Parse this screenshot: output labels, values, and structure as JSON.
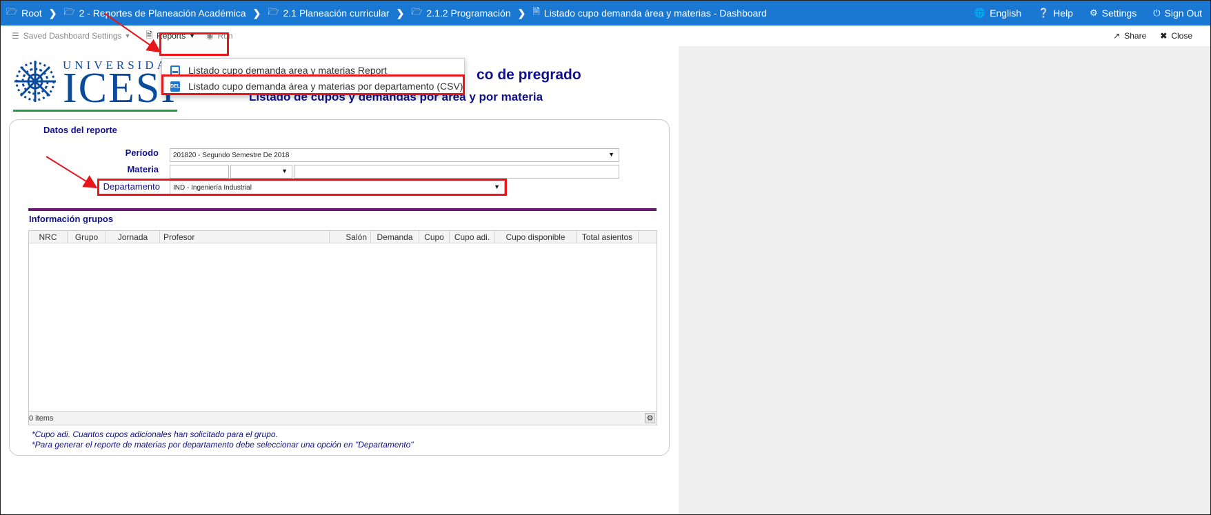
{
  "breadcrumb": [
    {
      "label": "Root"
    },
    {
      "label": "2 - Reportes de Planeación Académica"
    },
    {
      "label": "2.1 Planeación curricular"
    },
    {
      "label": "2.1.2 Programación"
    },
    {
      "label": "Listado cupo demanda área y materias - Dashboard"
    }
  ],
  "topnav": {
    "english": "English",
    "help": "Help",
    "settings": "Settings",
    "signout": "Sign Out"
  },
  "toolbar": {
    "saved": "Saved Dashboard Settings",
    "reports": "Reports",
    "run": "Run",
    "share": "Share",
    "close": "Close"
  },
  "dropdown": {
    "item1": "Listado cupo demanda area y materias Report",
    "item2": "Listado cupo demanda área y materias por departamento (CSV)",
    "csv_badge": "DEL"
  },
  "logo": {
    "top": "UNIVERSIDAD",
    "main": "ICESI"
  },
  "titles": {
    "line1": "co de pregrado",
    "line2": "Listado de cupos y demandas por área y por materia"
  },
  "form": {
    "section_title": "Datos del reporte",
    "periodo_label": "Período",
    "periodo_value": "201820 - Segundo Semestre De 2018",
    "materia_label": "Materia",
    "departamento_label": "Departamento",
    "departamento_value": "IND - Ingeniería Industrial"
  },
  "grid": {
    "section_title": "Información grupos",
    "columns": [
      "NRC",
      "Grupo",
      "Jornada",
      "Profesor",
      "Salón",
      "Demanda",
      "Cupo",
      "Cupo adi.",
      "Cupo disponible",
      "Total asientos"
    ],
    "footer": "0 items"
  },
  "notes": {
    "n1": "*Cupo adi. Cuantos cupos adicionales han solicitado para el grupo.",
    "n2": "*Para generar el reporte de materias por departamento debe seleccionar una opción en \"Departamento\""
  },
  "colors": {
    "topbar": "#1a78d2",
    "highlight": "#e8151b",
    "title": "#11118a",
    "divider": "#6a1b6e"
  }
}
